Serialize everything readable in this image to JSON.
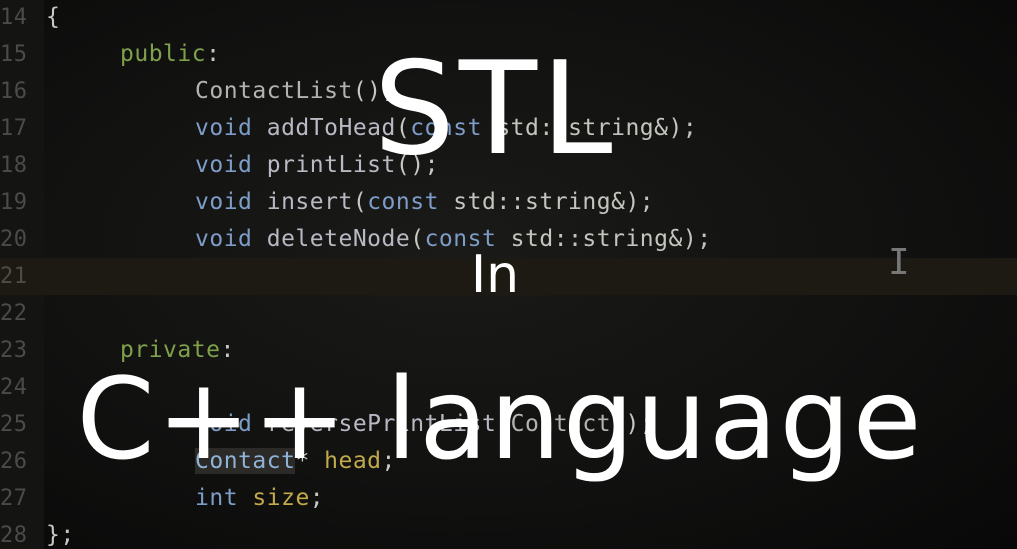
{
  "editor": {
    "lines": [
      {
        "num": "14",
        "tokens": [
          {
            "t": "{",
            "c": "punc"
          }
        ]
      },
      {
        "num": "15",
        "indent": 1,
        "tokens": [
          {
            "t": "public",
            "c": "kw-access"
          },
          {
            "t": ":",
            "c": "punc"
          }
        ]
      },
      {
        "num": "16",
        "indent": 2,
        "tokens": [
          {
            "t": "ContactList",
            "c": "cls"
          },
          {
            "t": "();",
            "c": "punc"
          }
        ]
      },
      {
        "num": "17",
        "indent": 2,
        "tokens": [
          {
            "t": "void",
            "c": "kw-type"
          },
          {
            "t": " addToHead",
            "c": "fn"
          },
          {
            "t": "(",
            "c": "punc"
          },
          {
            "t": "const",
            "c": "kw-type"
          },
          {
            "t": " std::string&);",
            "c": "ns"
          }
        ]
      },
      {
        "num": "18",
        "indent": 2,
        "tokens": [
          {
            "t": "void",
            "c": "kw-type"
          },
          {
            "t": " printList",
            "c": "fn"
          },
          {
            "t": "();",
            "c": "punc"
          }
        ]
      },
      {
        "num": "19",
        "indent": 2,
        "tokens": [
          {
            "t": "void",
            "c": "kw-type"
          },
          {
            "t": " insert",
            "c": "fn"
          },
          {
            "t": "(",
            "c": "punc"
          },
          {
            "t": "const",
            "c": "kw-type"
          },
          {
            "t": " std::string&);",
            "c": "ns"
          }
        ]
      },
      {
        "num": "20",
        "indent": 2,
        "tokens": [
          {
            "t": "void",
            "c": "kw-type"
          },
          {
            "t": " deleteNode",
            "c": "fn"
          },
          {
            "t": "(",
            "c": "punc"
          },
          {
            "t": "const",
            "c": "kw-type"
          },
          {
            "t": " std::string&);",
            "c": "ns"
          }
        ]
      },
      {
        "num": "21",
        "current": true,
        "tokens": []
      },
      {
        "num": "22",
        "tokens": []
      },
      {
        "num": "23",
        "indent": 1,
        "tokens": [
          {
            "t": "private",
            "c": "kw-access"
          },
          {
            "t": ":",
            "c": "punc"
          }
        ]
      },
      {
        "num": "24",
        "tokens": []
      },
      {
        "num": "25",
        "indent": 2,
        "tokens": [
          {
            "t": "void",
            "c": "kw-type"
          },
          {
            "t": " reversePrintList",
            "c": "fn"
          },
          {
            "t": "(",
            "c": "punc"
          },
          {
            "t": "Contact",
            "c": "cls"
          },
          {
            "t": "*);",
            "c": "punc"
          }
        ]
      },
      {
        "num": "26",
        "indent": 2,
        "tokens": [
          {
            "t": "Contact",
            "c": "cls-hl"
          },
          {
            "t": "* ",
            "c": "punc"
          },
          {
            "t": "head",
            "c": "var"
          },
          {
            "t": ";",
            "c": "punc"
          }
        ]
      },
      {
        "num": "27",
        "indent": 2,
        "tokens": [
          {
            "t": "int",
            "c": "kw-type"
          },
          {
            "t": " ",
            "c": "punc"
          },
          {
            "t": "size",
            "c": "var"
          },
          {
            "t": ";",
            "c": "punc"
          }
        ]
      },
      {
        "num": "28",
        "tokens": [
          {
            "t": "};",
            "c": "punc"
          }
        ]
      }
    ],
    "cursor_icon": "text-cursor-icon"
  },
  "overlay": {
    "title": "STL",
    "connector": "In",
    "subtitle": "C++ language"
  }
}
